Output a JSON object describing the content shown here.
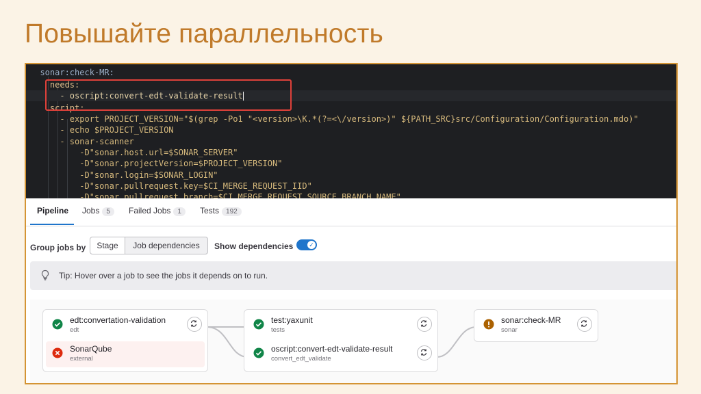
{
  "slide": {
    "title": "Повышайте параллельность"
  },
  "code": {
    "lines": [
      "  sonar:check-MR:",
      "    needs:",
      "      - oscript:convert-edt-validate-result",
      "    script:",
      "      - export PROJECT_VERSION=\"$(grep -Po1 \"<version>\\K.*(?=<\\/version>)\" ${PATH_SRC}src/Configuration/Configuration.mdo)\"",
      "      - echo $PROJECT_VERSION",
      "      - sonar-scanner",
      "          -D\"sonar.host.url=$SONAR_SERVER\"",
      "          -D\"sonar.projectVersion=$PROJECT_VERSION\"",
      "          -D\"sonar.login=$SONAR_LOGIN\"",
      "          -D\"sonar.pullrequest.key=$CI_MERGE_REQUEST_IID\"",
      "          -D\"sonar.pullrequest.branch=$CI_MERGE_REQUEST_SOURCE_BRANCH_NAME\""
    ]
  },
  "tabs": [
    {
      "label": "Pipeline",
      "count": ""
    },
    {
      "label": "Jobs",
      "count": "5"
    },
    {
      "label": "Failed Jobs",
      "count": "1"
    },
    {
      "label": "Tests",
      "count": "192"
    }
  ],
  "controls": {
    "group_label": "Group jobs by",
    "stage_option": "Stage",
    "deps_option": "Job dependencies",
    "show_deps_label": "Show dependencies",
    "show_deps_on": true
  },
  "tip": {
    "icon": "lightbulb-icon",
    "text": "Tip: Hover over a job to see the jobs it depends on to run."
  },
  "graph": {
    "jobs": [
      {
        "name": "edt:convertation-validation",
        "sub": "edt",
        "status": "success"
      },
      {
        "name": "SonarQube",
        "sub": "external",
        "status": "failed"
      },
      {
        "name": "test:yaxunit",
        "sub": "tests",
        "status": "success"
      },
      {
        "name": "oscript:convert-edt-validate-result",
        "sub": "convert_edt_validate",
        "status": "success"
      },
      {
        "name": "sonar:check-MR",
        "sub": "sonar",
        "status": "warning"
      }
    ]
  },
  "colors": {
    "accent": "#c07a2a",
    "frame": "#d49434",
    "highlight": "#e0413a",
    "success": "#108548",
    "failed": "#dd2b0e",
    "warning": "#ab6100",
    "primary": "#1f75cb"
  }
}
